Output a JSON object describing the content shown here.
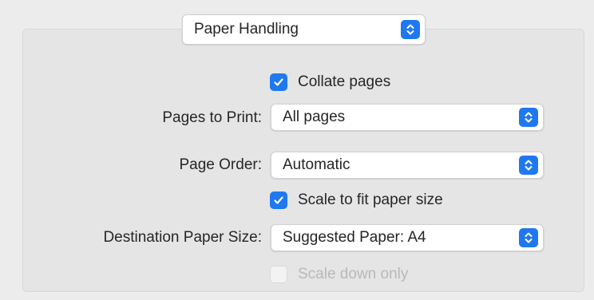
{
  "section_popup": {
    "selected": "Paper Handling",
    "icon": "chevron-up-down-icon"
  },
  "collate": {
    "label": "Collate pages",
    "checked": true
  },
  "pages_to_print": {
    "label": "Pages to Print:",
    "selected": "All pages"
  },
  "page_order": {
    "label": "Page Order:",
    "selected": "Automatic"
  },
  "scale_to_fit": {
    "label": "Scale to fit paper size",
    "checked": true
  },
  "destination_paper_size": {
    "label": "Destination Paper Size:",
    "selected": "Suggested Paper: A4"
  },
  "scale_down_only": {
    "label": "Scale down only",
    "checked": false,
    "enabled": false
  },
  "colors": {
    "accent": "#1f78f0",
    "background": "#ececec",
    "disabled_text": "#b9b9b9"
  }
}
